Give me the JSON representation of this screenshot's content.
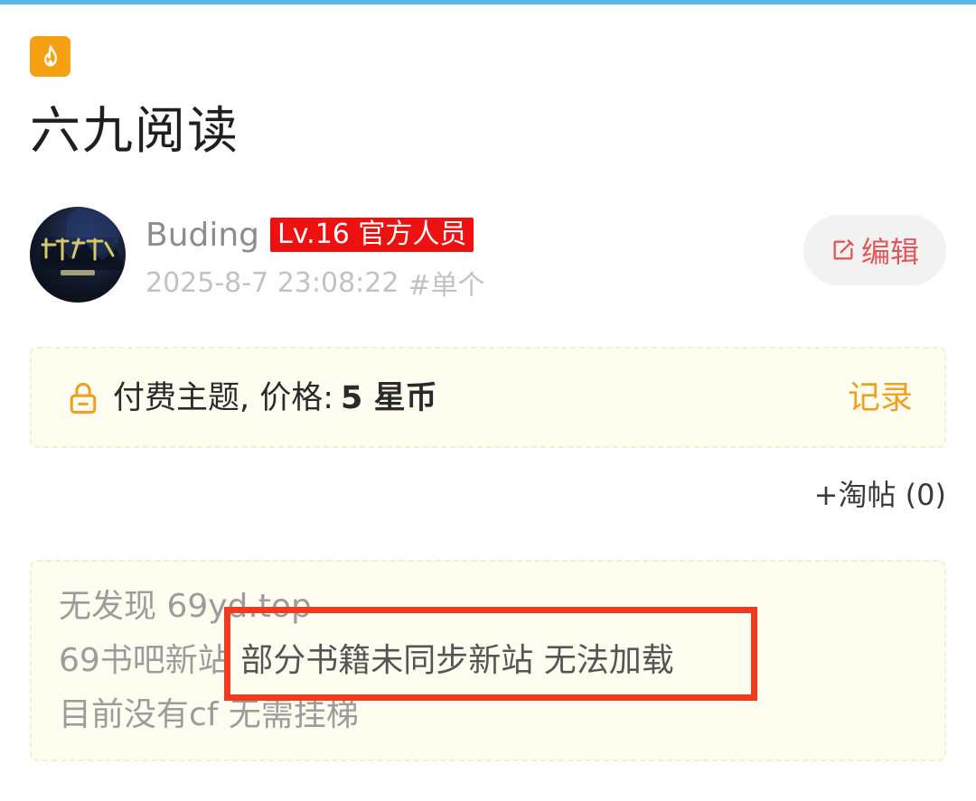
{
  "post": {
    "title": "六九阅读",
    "hot_icon": "flame-icon"
  },
  "author": {
    "name": "Buding",
    "level_badge": "Lv.16 官方人员",
    "datetime": "2025-8-7 23:08:22",
    "tag": "#单个",
    "avatar_icon": "avatar-image"
  },
  "actions": {
    "edit_label": "编辑",
    "edit_icon": "edit-icon",
    "tao_label": "+淘帖 (0)"
  },
  "paid": {
    "label": "付费主题, 价格:",
    "price": "5 星币",
    "record_label": "记录",
    "lock_icon": "lock-icon"
  },
  "content": {
    "line1": "无发现 69yd.top",
    "line2_prefix": "69书吧新站 ",
    "line2_highlight": "部分书籍未同步新站 无法加载",
    "line3": "目前没有cf 无需挂梯"
  },
  "colors": {
    "accent_orange": "#f5a113",
    "badge_red": "#ee1111",
    "edit_red": "#e2555b",
    "record_orange": "#f0a020",
    "annotation_red": "#f03b1f",
    "top_bar": "#5bb8e6"
  }
}
